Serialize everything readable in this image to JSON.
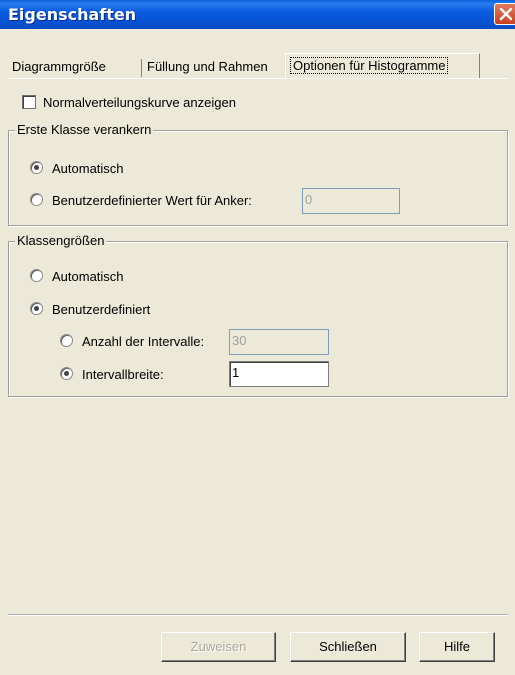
{
  "window": {
    "title": "Eigenschaften"
  },
  "tabs": [
    {
      "label": "Diagrammgröße"
    },
    {
      "label": "Füllung und Rahmen"
    },
    {
      "label": "Optionen für Histogramme"
    }
  ],
  "normal_curve": {
    "label": "Normalverteilungskurve anzeigen",
    "checked": false
  },
  "anchor_group": {
    "title": "Erste Klasse verankern",
    "options": [
      {
        "label": "Automatisch",
        "selected": true
      },
      {
        "label": "Benutzerdefinierter Wert für Anker:",
        "selected": false
      }
    ],
    "anchor_value": "0"
  },
  "size_group": {
    "title": "Klassengrößen",
    "options": [
      {
        "label": "Automatisch",
        "selected": false
      },
      {
        "label": "Benutzerdefiniert",
        "selected": true
      }
    ],
    "sub_options": [
      {
        "label": "Anzahl der Intervalle:",
        "selected": false,
        "value": "30"
      },
      {
        "label": "Intervallbreite:",
        "selected": true,
        "value": "1"
      }
    ]
  },
  "buttons": {
    "apply": "Zuweisen",
    "close": "Schließen",
    "help": "Hilfe"
  }
}
